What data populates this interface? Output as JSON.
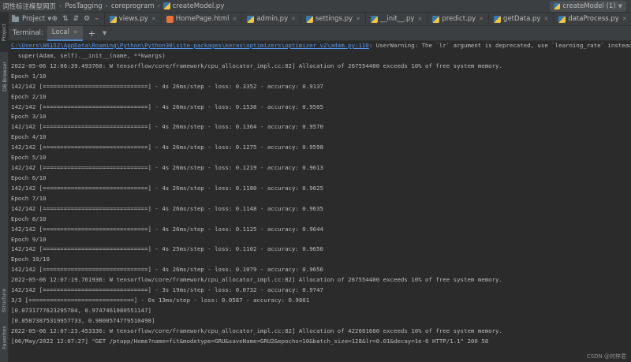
{
  "breadcrumb": [
    "词性标注模型网页",
    "PosTagging",
    "coreprogram",
    "createModel.py"
  ],
  "run_config": {
    "label": "createModel (1)"
  },
  "left_stripe": {
    "tabs": [
      "Project",
      "DB Browser",
      "Structure",
      "Favorites"
    ]
  },
  "project_tab": {
    "label": "Project"
  },
  "editor_tabs": [
    {
      "label": "views.py",
      "icon": "python-file-icon"
    },
    {
      "label": "HomePage.html",
      "icon": "html-file-icon"
    },
    {
      "label": "admin.py",
      "icon": "python-file-icon"
    },
    {
      "label": "settings.py",
      "icon": "python-file-icon"
    },
    {
      "label": "__init__.py",
      "icon": "python-file-icon"
    },
    {
      "label": "predict.py",
      "icon": "python-file-icon"
    },
    {
      "label": "getData.py",
      "icon": "python-file-icon"
    },
    {
      "label": "dataProcess.py",
      "icon": "python-file-icon"
    }
  ],
  "terminal": {
    "label": "Terminal:",
    "tab": "Local",
    "link": "C:\\Users\\86152\\AppData\\Roaming\\Python\\Python38\\site-packages\\keras\\optimizers\\optimizer_v2\\adam.py:110",
    "link_suffix": ": UserWarning: The `lr` argument is deprecated, use `learning_rate` instead.",
    "lines": [
      "  super(Adam, self).__init__(name, **kwargs)",
      "2022-05-06 12:06:39.493760: W tensorflow/core/framework/cpu_allocator_impl.cc:82] Allocation of 267554400 exceeds 10% of free system memory.",
      "Epoch 1/10",
      "142/142 [==============================] - 4s 26ms/step - loss: 0.3352 - accuracy: 0.9137",
      "Epoch 2/10",
      "142/142 [==============================] - 4s 26ms/step - loss: 0.1538 - accuracy: 0.9505",
      "Epoch 3/10",
      "142/142 [==============================] - 4s 26ms/step - loss: 0.1364 - accuracy: 0.9570",
      "Epoch 4/10",
      "142/142 [==============================] - 4s 26ms/step - loss: 0.1275 - accuracy: 0.9598",
      "Epoch 5/10",
      "142/142 [==============================] - 4s 26ms/step - loss: 0.1219 - accuracy: 0.9613",
      "Epoch 6/10",
      "142/142 [==============================] - 4s 26ms/step - loss: 0.1180 - accuracy: 0.9625",
      "Epoch 7/10",
      "142/142 [==============================] - 4s 26ms/step - loss: 0.1148 - accuracy: 0.9635",
      "Epoch 8/10",
      "142/142 [==============================] - 4s 26ms/step - loss: 0.1125 - accuracy: 0.9644",
      "Epoch 9/10",
      "142/142 [==============================] - 4s 25ms/step - loss: 0.1102 - accuracy: 0.9650",
      "Epoch 10/10",
      "142/142 [==============================] - 4s 26ms/step - loss: 0.1079 - accuracy: 0.9656",
      "2022-05-06 12:07:19.761936: W tensorflow/core/framework/cpu_allocator_impl.cc:82] Allocation of 267554400 exceeds 10% of free system memory.",
      "142/142 [==============================] - 3s 19ms/step - loss: 0.0732 - accuracy: 0.9747",
      "3/3 [==============================] - 0s 13ms/step - loss: 0.0587 - accuracy: 0.9801",
      "[0.0731777623295784, 0.9747461080551147]",
      "[0.05873875319957733, 0.9800574779510498]",
      "2022-05-06 12:07:23.453336: W tensorflow/core/framework/cpu_allocator_impl.cc:82] Allocation of 422661600 exceeds 10% of free system memory.",
      "[06/May/2022 12:07:27] \"GET /ptapp/Home?name=fit&modetype=GRU&saveName=GRU2&epochs=10&batch_size=128&lr=0.01&decay=1e-6 HTTP/1.1\" 200 58"
    ]
  },
  "watermark": "CSDN @何梓君"
}
